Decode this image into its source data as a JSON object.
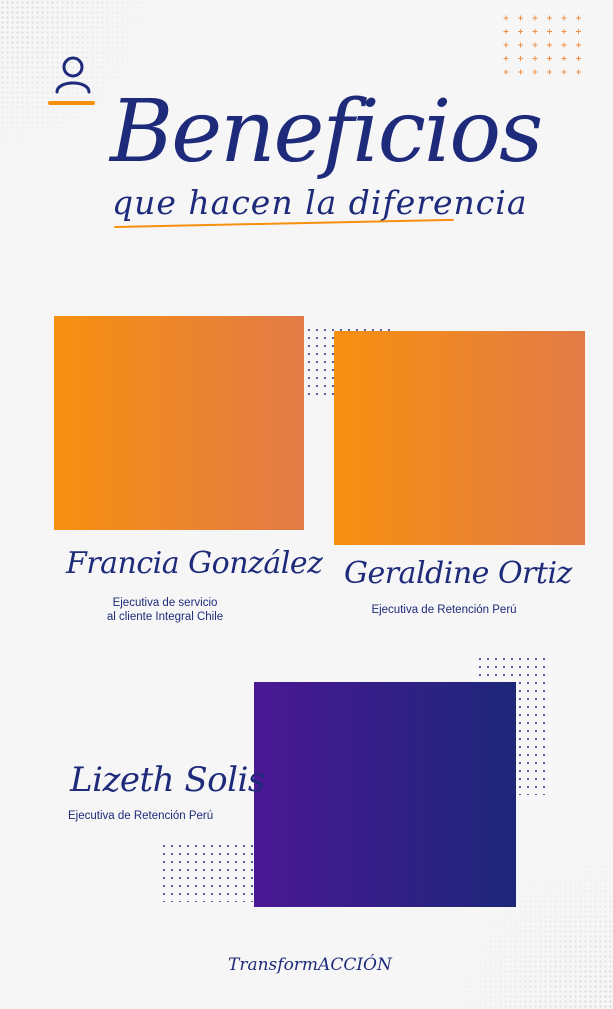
{
  "header": {
    "title": "Beneficios",
    "subtitle": "que hacen la diferencia"
  },
  "people": [
    {
      "name": "Francia González",
      "role_line1": "Ejecutiva de servicio",
      "role_line2": "al cliente Integral Chile"
    },
    {
      "name": "Geraldine Ortiz",
      "role_line1": "Ejecutiva de Retención Perú"
    },
    {
      "name": "Lizeth Solis",
      "role_line1": "Ejecutiva de Retención Perú"
    }
  ],
  "footer": {
    "brand_prefix": "Transform",
    "brand_suffix": "ACCIÓN"
  },
  "colors": {
    "navy": "#1e2a7a",
    "orange": "#f7900f",
    "orange_end": "#e27b47",
    "purple": "#4a1894",
    "purple_end": "#1d2779",
    "background": "#f6f6f7"
  },
  "icons": [
    "user-icon"
  ]
}
